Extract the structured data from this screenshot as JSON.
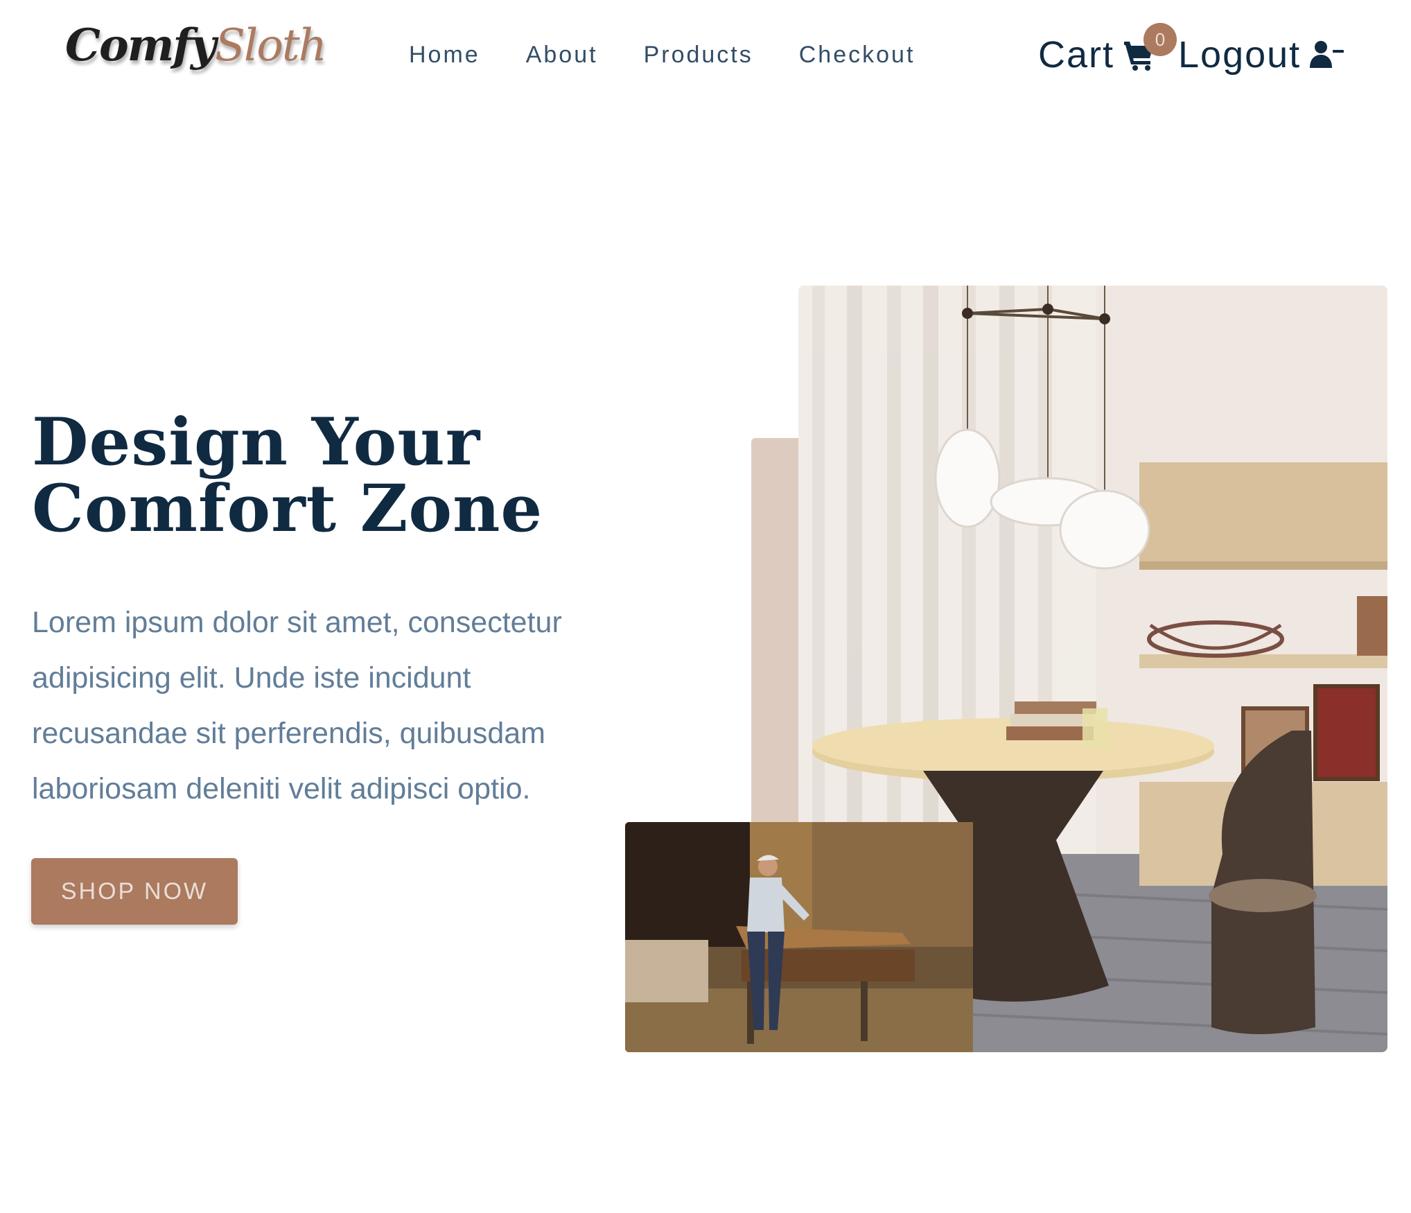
{
  "brand": {
    "part1": "Comfy",
    "part2": "Sloth"
  },
  "nav": {
    "links": [
      {
        "label": "Home"
      },
      {
        "label": "About"
      },
      {
        "label": "Products"
      },
      {
        "label": "Checkout"
      }
    ],
    "cart_label": "Cart",
    "cart_count": "0",
    "logout_label": "Logout"
  },
  "hero": {
    "title_line1": "Design Your",
    "title_line2": "Comfort Zone",
    "text": "Lorem ipsum dolor sit amet, consectetur adipisicing elit. Unde iste incidunt recusandae sit perferendis, quibusdam laboriosam deleniti velit adipisci optio.",
    "button_label": "SHOP NOW"
  },
  "colors": {
    "primary": "#ab7a5f",
    "primary_light": "#decbc0",
    "heading": "#102a42",
    "body_text": "#617d98",
    "nav_text": "#324d67",
    "button_text": "#eaded7"
  },
  "icons": {
    "cart": "shopping-cart-icon",
    "logout": "user-minus-icon"
  }
}
